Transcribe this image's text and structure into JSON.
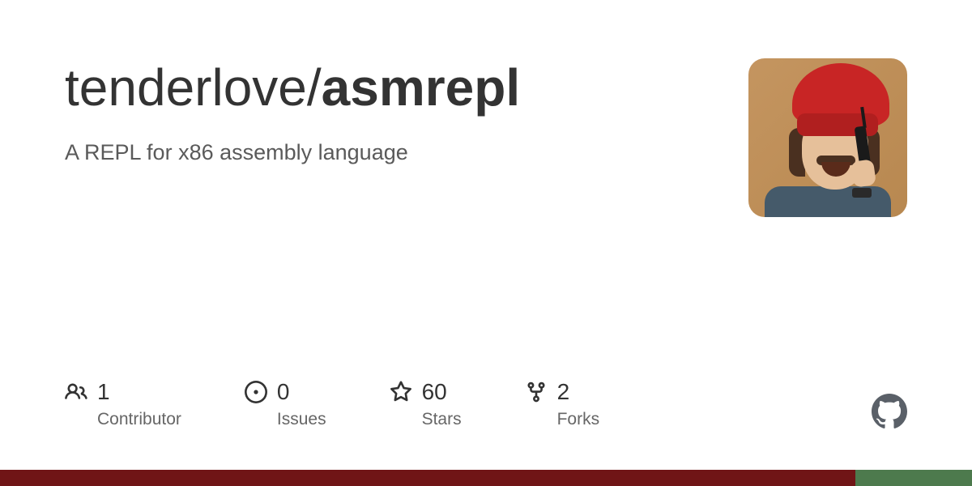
{
  "repo": {
    "owner": "tenderlove",
    "name": "asmrepl",
    "description": "A REPL for x86 assembly language"
  },
  "stats": {
    "contributors": {
      "value": "1",
      "label": "Contributor"
    },
    "issues": {
      "value": "0",
      "label": "Issues"
    },
    "stars": {
      "value": "60",
      "label": "Stars"
    },
    "forks": {
      "value": "2",
      "label": "Forks"
    }
  },
  "colors": {
    "primary_lang": "#701516",
    "secondary_lang": "#4d7a4d"
  }
}
